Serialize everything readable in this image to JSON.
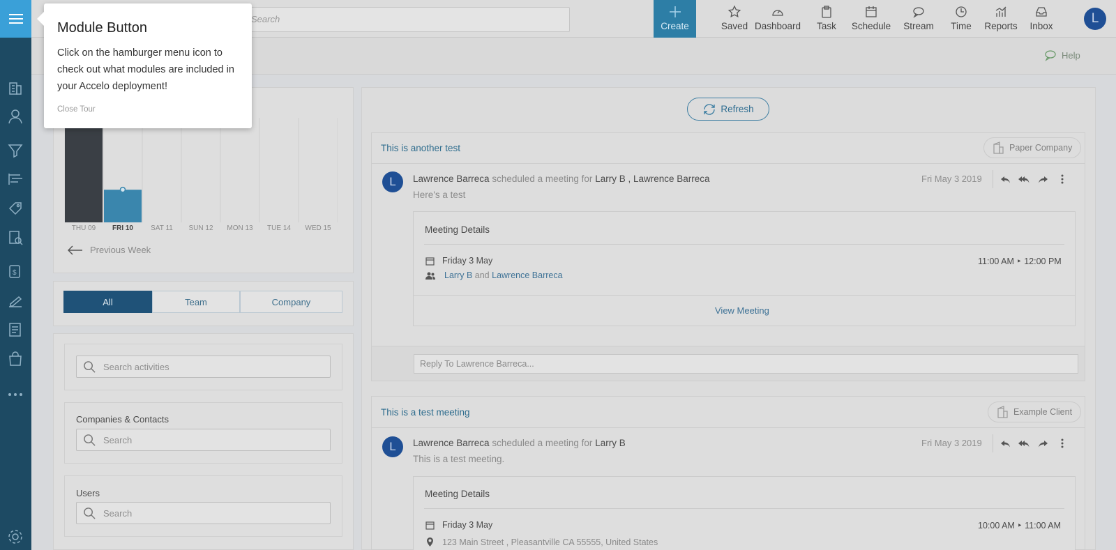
{
  "topbar": {
    "search_placeholder": "Search",
    "nav": [
      {
        "label": "Create",
        "icon": "plus-icon"
      },
      {
        "label": "Saved",
        "icon": "star-icon"
      },
      {
        "label": "Dashboard",
        "icon": "gauge-icon"
      },
      {
        "label": "Task",
        "icon": "clipboard-icon"
      },
      {
        "label": "Schedule",
        "icon": "calendar-icon"
      },
      {
        "label": "Stream",
        "icon": "chat-bubbles-icon"
      },
      {
        "label": "Time",
        "icon": "clock-icon"
      },
      {
        "label": "Reports",
        "icon": "bar-chart-icon"
      },
      {
        "label": "Inbox",
        "icon": "inbox-icon"
      }
    ],
    "avatar_initial": "L"
  },
  "subbar": {
    "help_label": "Help"
  },
  "chart_data": {
    "type": "bar",
    "categories": [
      "THU 09",
      "FRI 10",
      "SAT 11",
      "SUN 12",
      "MON 13",
      "TUE 14",
      "WED 15"
    ],
    "values": [
      100,
      33,
      0,
      0,
      0,
      0,
      0
    ],
    "colors": [
      "#3a3f45",
      "#3a86ad"
    ],
    "selected_category": "FRI 10"
  },
  "week_nav": {
    "previous_label": "Previous Week"
  },
  "filters": {
    "tabs": [
      "All",
      "Team",
      "Company"
    ],
    "active_tab": "All",
    "activities_placeholder": "Search activities",
    "companies_label": "Companies & Contacts",
    "companies_placeholder": "Search",
    "users_label": "Users",
    "users_placeholder": "Search"
  },
  "stream": {
    "refresh_label": "Refresh",
    "cards": [
      {
        "title": "This is another test",
        "tag": "Paper Company",
        "avatar": "L",
        "author": "Lawrence Barreca",
        "action": "scheduled a meeting for",
        "recipients": "Larry B , Lawrence Barreca",
        "date": "Fri May 3 2019",
        "body": "Here's a test",
        "meeting_title": "Meeting Details",
        "meeting_date": "Friday 3 May",
        "meeting_time": "11:00 AM ‣ 12:00 PM",
        "attendee_1": "Larry B",
        "attendee_join": "and",
        "attendee_2": "Lawrence Barreca",
        "view_label": "View Meeting",
        "reply_placeholder": "Reply To Lawrence Barreca..."
      },
      {
        "title": "This is a test meeting",
        "tag": "Example Client",
        "avatar": "L",
        "author": "Lawrence Barreca",
        "action": "scheduled a meeting for",
        "recipients": "Larry B",
        "date": "Fri May 3 2019",
        "body": "This is a test meeting.",
        "meeting_title": "Meeting Details",
        "meeting_date": "Friday 3 May",
        "meeting_time": "10:00 AM ‣ 11:00 AM",
        "location": "123 Main Street , Pleasantville CA 55555, United States"
      }
    ]
  },
  "tour": {
    "title": "Module Button",
    "body": "Click on the hamburger menu icon to check out what modules are included in your Accelo deployment!",
    "close_label": "Close Tour"
  }
}
